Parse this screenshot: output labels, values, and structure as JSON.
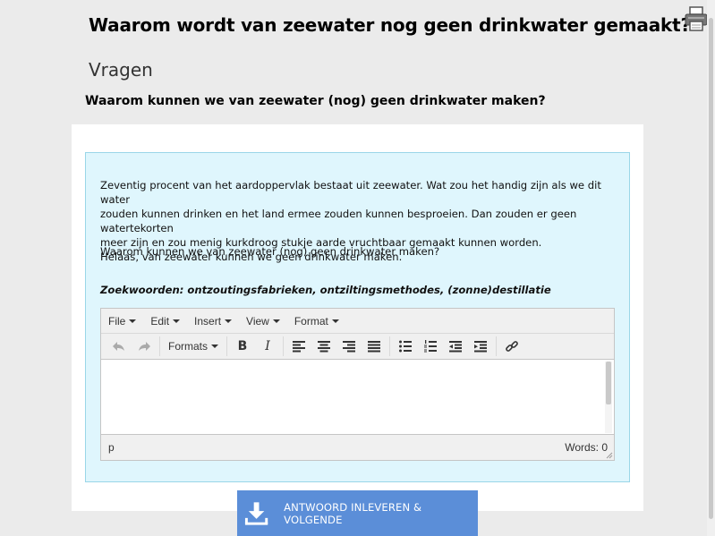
{
  "page": {
    "title": "Waarom wordt van zeewater nog geen drinkwater gemaakt?",
    "section": "Vragen",
    "question_title": "Waarom kunnen we van zeewater (nog) geen drinkwater maken?"
  },
  "question": {
    "intro_lines": [
      "Zeventig procent van het aardoppervlak bestaat uit zeewater. Wat zou het handig zijn als we dit water",
      "zouden kunnen drinken en het land ermee zouden kunnen besproeien. Dan zouden er geen watertekorten",
      "meer zijn en zou menig kurkdroog stukje aarde vruchtbaar gemaakt kunnen worden.",
      "Helaas, van zeewater kunnen we geen drinkwater maken."
    ],
    "question": "Waarom kunnen we van zeewater (nog) geen drinkwater maken?",
    "keywords": "Zoekwoorden: ontzoutingsfabrieken, ontziltingsmethodes, (zonne)destillatie"
  },
  "editor": {
    "menu": [
      "File",
      "Edit",
      "Insert",
      "View",
      "Format"
    ],
    "formats_label": "Formats",
    "bold_label": "B",
    "italic_label": "I",
    "content": "",
    "path": "p",
    "word_count": "Words: 0"
  },
  "submit": {
    "label": "ANTWOORD INLEVEREN & VOLGENDE"
  },
  "colors": {
    "background": "#ebebeb",
    "question_box": "#dff6fd",
    "question_border": "#9ad6e8",
    "submit_button": "#5b8ed8"
  },
  "icons": [
    "printer-icon",
    "undo-icon",
    "redo-icon",
    "align-left-icon",
    "align-center-icon",
    "align-right-icon",
    "align-justify-icon",
    "bullet-list-icon",
    "numbered-list-icon",
    "outdent-icon",
    "indent-icon",
    "link-icon",
    "download-icon"
  ]
}
